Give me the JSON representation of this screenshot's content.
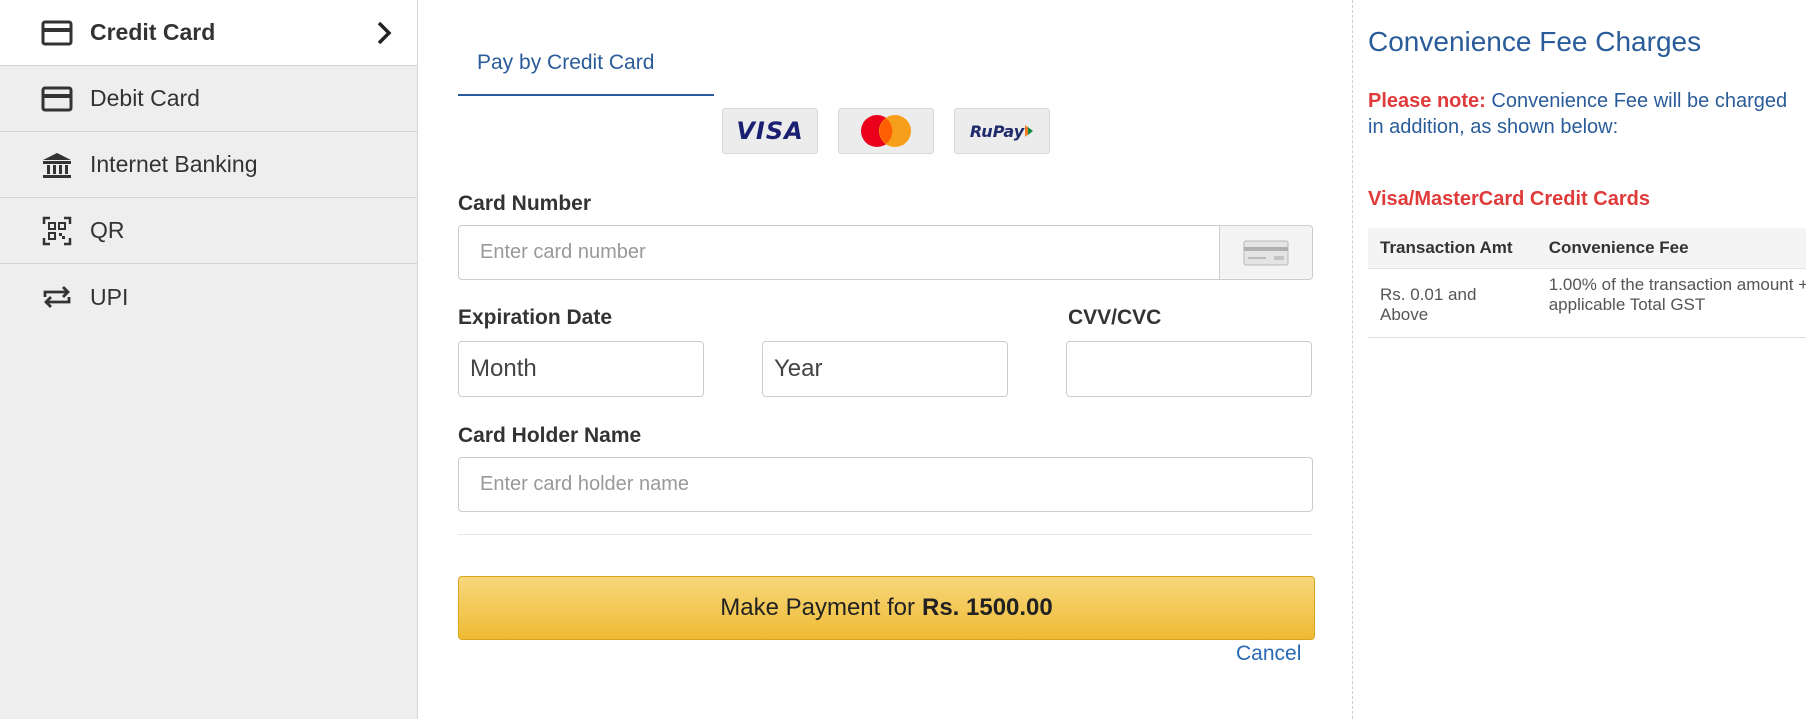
{
  "sidebar": {
    "items": [
      {
        "label": "Credit Card",
        "icon": "credit-card-icon",
        "active": true
      },
      {
        "label": "Debit Card",
        "icon": "debit-card-icon"
      },
      {
        "label": "Internet Banking",
        "icon": "bank-icon"
      },
      {
        "label": "QR",
        "icon": "qr-code-icon"
      },
      {
        "label": "UPI",
        "icon": "upi-arrows-icon"
      }
    ]
  },
  "main": {
    "tab_label": "Pay by Credit Card",
    "card_logos": [
      "VISA",
      "mastercard",
      "RuPay"
    ],
    "card_number": {
      "label": "Card Number",
      "placeholder": "Enter card number"
    },
    "expiration": {
      "label": "Expiration Date",
      "month": "Month",
      "year": "Year"
    },
    "cvv": {
      "label": "CVV/CVC",
      "value": ""
    },
    "holder": {
      "label": "Card Holder Name",
      "placeholder": "Enter card holder name"
    },
    "pay_button": {
      "prefix": "Make Payment for",
      "amount": "Rs. 1500.00"
    },
    "cancel_label": "Cancel"
  },
  "fee": {
    "title": "Convenience Fee Charges",
    "note_label": "Please note:",
    "note_text": "Convenience Fee will be charged in addition, as shown below:",
    "subheading": "Visa/MasterCard Credit Cards",
    "table": {
      "headers": [
        "Transaction Amt",
        "Convenience Fee"
      ],
      "rows": [
        [
          "Rs. 0.01 and Above",
          "1.00% of the transaction amount + applicable Total GST"
        ]
      ]
    }
  },
  "colors": {
    "accent": "#2a5c9a",
    "warning_red": "#e03b3b",
    "pay_button": "#efbb33",
    "sidebar_bg": "#eeeeee"
  }
}
